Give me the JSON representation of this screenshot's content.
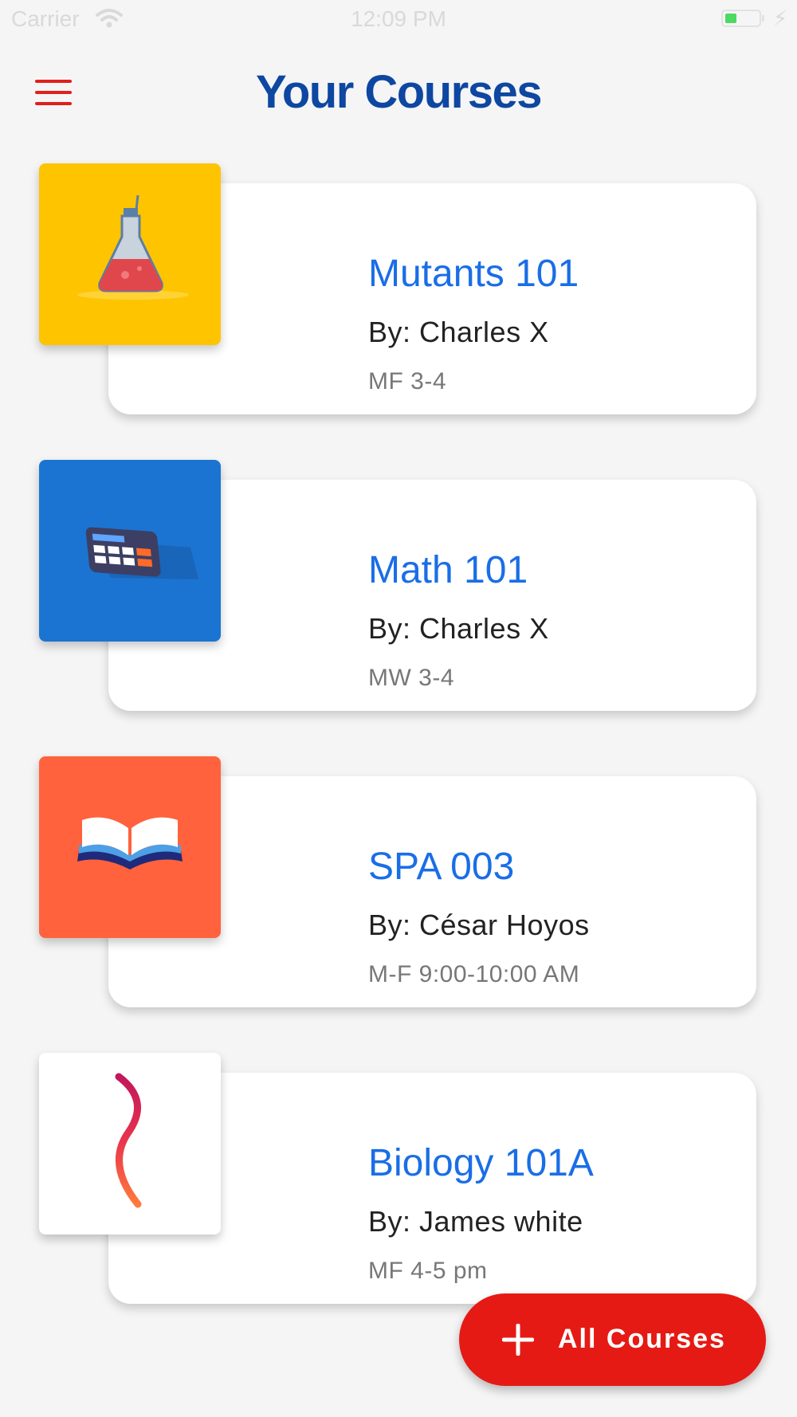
{
  "status_bar": {
    "carrier": "Carrier",
    "time": "12:09 PM"
  },
  "header": {
    "title": "Your Courses",
    "menu_icon": "hamburger-menu-icon"
  },
  "courses": [
    {
      "name": "Mutants 101",
      "instructor": "By: Charles X",
      "schedule": "MF 3-4",
      "thumbnail_color": "#ffc400",
      "icon": "flask-icon"
    },
    {
      "name": "Math 101",
      "instructor": "By: Charles X",
      "schedule": "MW 3-4",
      "thumbnail_color": "#1b74d1",
      "icon": "calculator-icon"
    },
    {
      "name": "SPA 003",
      "instructor": "By: César Hoyos",
      "schedule": "M-F 9:00-10:00 AM",
      "thumbnail_color": "#ff623d",
      "icon": "open-book-icon"
    },
    {
      "name": "Biology 101A",
      "instructor": "By: James white",
      "schedule": "MF 4-5 pm",
      "thumbnail_color": "#ffffff",
      "icon": "dna-icon"
    }
  ],
  "fab": {
    "label": "All Courses",
    "icon": "plus-icon"
  },
  "colors": {
    "accent": "#e51a14",
    "title": "#0d47a1",
    "course_name": "#1a6ee6"
  }
}
